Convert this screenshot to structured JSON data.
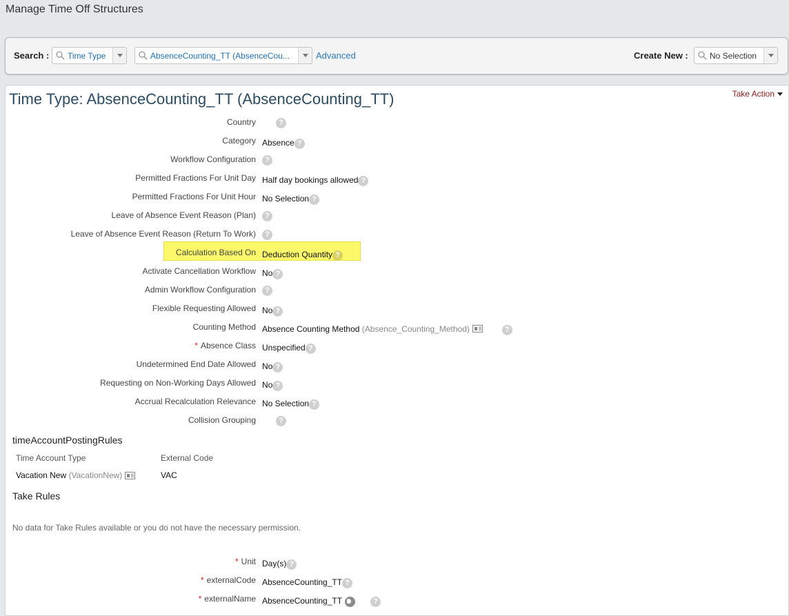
{
  "page_title": "Manage Time Off Structures",
  "search": {
    "label": "Search :",
    "type_value": "Time Type",
    "record_value": "AbsenceCounting_TT (AbsenceCou...",
    "advanced_link": "Advanced",
    "create_label": "Create New :",
    "create_value": "No Selection"
  },
  "record": {
    "title": "Time Type: AbsenceCounting_TT (AbsenceCounting_TT)",
    "take_action": "Take Action"
  },
  "fields": [
    {
      "label": "Country",
      "value": "",
      "required": false
    },
    {
      "label": "Category",
      "value": "Absence",
      "required": false
    },
    {
      "label": "Workflow Configuration",
      "value": "",
      "required": false
    },
    {
      "label": "Permitted Fractions For Unit Day",
      "value": "Half day bookings allowed",
      "required": false
    },
    {
      "label": "Permitted Fractions For Unit Hour",
      "value": "No Selection",
      "required": false
    },
    {
      "label": "Leave of Absence Event Reason (Plan)",
      "value": "",
      "required": false
    },
    {
      "label": "Leave of Absence Event Reason (Return To Work)",
      "value": "",
      "required": false
    },
    {
      "label": "Calculation Based On",
      "value": "Deduction Quantity",
      "required": false
    },
    {
      "label": "Activate Cancellation Workflow",
      "value": "No",
      "required": false
    },
    {
      "label": "Admin Workflow Configuration",
      "value": "",
      "required": false
    },
    {
      "label": "Flexible Requesting Allowed",
      "value": "No",
      "required": false
    },
    {
      "label": "Counting Method",
      "value": "Absence Counting Method",
      "value_code": "(Absence_Counting_Method)",
      "required": false
    },
    {
      "label": "Absence Class",
      "value": "Unspecified",
      "required": true
    },
    {
      "label": "Undetermined End Date Allowed",
      "value": "No",
      "required": false
    },
    {
      "label": "Requesting on Non-Working Days Allowed",
      "value": "No",
      "required": false
    },
    {
      "label": "Accrual Recalculation Relevance",
      "value": "No Selection",
      "required": false
    },
    {
      "label": "Collision Grouping",
      "value": "",
      "required": false
    }
  ],
  "posting_rules": {
    "title": "timeAccountPostingRules",
    "columns": [
      "Time Account Type",
      "External Code"
    ],
    "rows": [
      {
        "type_name": "Vacation New",
        "type_code": "(VacationNew)",
        "external_code": "VAC"
      }
    ]
  },
  "take_rules": {
    "title": "Take Rules",
    "empty_message": "No data for Take Rules available or you do not have the necessary permission."
  },
  "bottom_fields": [
    {
      "label": "Unit",
      "value": "Day(s)",
      "required": true
    },
    {
      "label": "externalCode",
      "value": "AbsenceCounting_TT",
      "required": true
    },
    {
      "label": "externalName",
      "value": "AbsenceCounting_TT",
      "required": true
    }
  ],
  "help_glyph": "?",
  "required_glyph": "*",
  "colors": {
    "highlight": "#fbf86a",
    "link": "#2a7ab8",
    "take_action": "#8b1b1b",
    "title": "#2b4c63"
  }
}
